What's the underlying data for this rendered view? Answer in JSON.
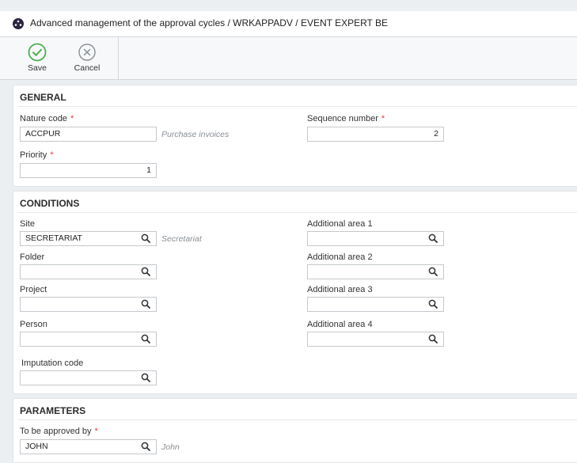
{
  "window": {
    "title": "Advanced management of the approval cycles / WRKAPPADV / EVENT EXPERT BE"
  },
  "toolbar": {
    "save_label": "Save",
    "cancel_label": "Cancel"
  },
  "general": {
    "title": "GENERAL",
    "nature_code": {
      "label": "Nature code",
      "value": "ACCPUR",
      "hint": "Purchase invoices"
    },
    "sequence_number": {
      "label": "Sequence number",
      "value": "2"
    },
    "priority": {
      "label": "Priority",
      "value": "1"
    },
    "required_mark": "*"
  },
  "conditions": {
    "title": "CONDITIONS",
    "site": {
      "label": "Site",
      "value": "SECRETARIAT",
      "hint": "Secretariat"
    },
    "folder": {
      "label": "Folder",
      "value": ""
    },
    "project": {
      "label": "Project",
      "value": ""
    },
    "person": {
      "label": "Person",
      "value": ""
    },
    "imputation_code": {
      "label": "Imputation code",
      "value": ""
    },
    "additional_area_1": {
      "label": "Additional area 1",
      "value": ""
    },
    "additional_area_2": {
      "label": "Additional area 2",
      "value": ""
    },
    "additional_area_3": {
      "label": "Additional area 3",
      "value": ""
    },
    "additional_area_4": {
      "label": "Additional area 4",
      "value": ""
    }
  },
  "parameters": {
    "title": "PARAMETERS",
    "to_be_approved_by": {
      "label": "To be approved by",
      "value": "JOHN",
      "hint": "John"
    },
    "required_mark": "*"
  },
  "colors": {
    "save_green": "#4caf50",
    "required_red": "#e53935",
    "hint_gray": "#8a8f94"
  },
  "icons": [
    "app-logo-icon",
    "checkmark-circle-icon",
    "x-circle-icon",
    "search-icon"
  ]
}
